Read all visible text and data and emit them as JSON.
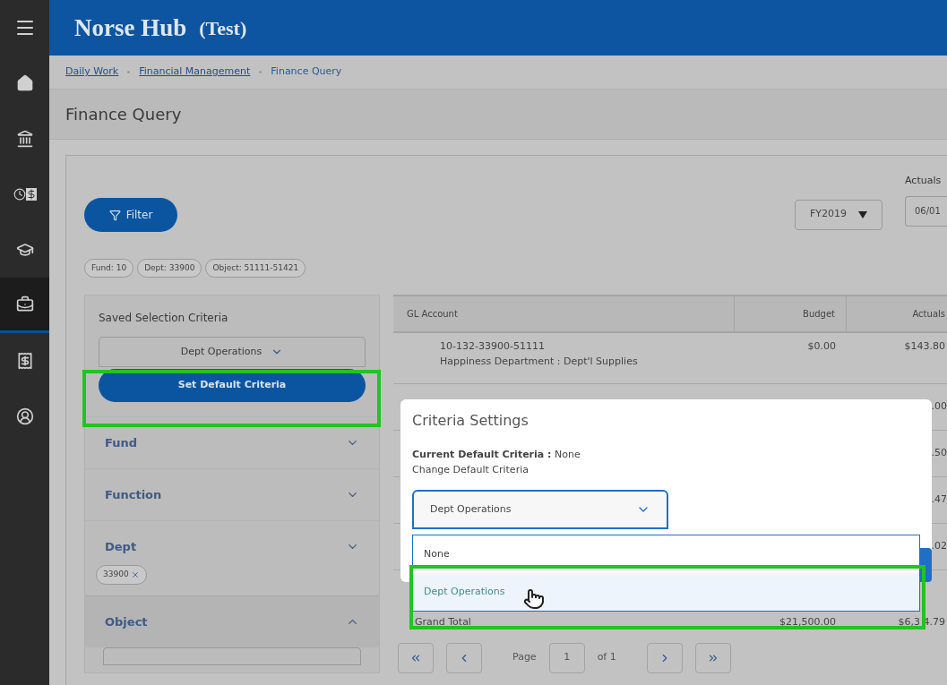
{
  "sidebar": {
    "items": [
      {
        "selected": false
      },
      {
        "selected": false
      },
      {
        "selected": false
      },
      {
        "selected": false
      },
      {
        "selected": true
      },
      {
        "selected": false
      },
      {
        "selected": false
      }
    ]
  },
  "header": {
    "title": "Norse Hub",
    "subtitle": "(Test)"
  },
  "breadcrumb": [
    {
      "label": "Daily Work",
      "link": true
    },
    {
      "label": "Financial Management",
      "link": true
    },
    {
      "label": "Finance Query",
      "link": false
    }
  ],
  "page_title": "Finance Query",
  "filter_button": "Filter",
  "fiscal_year": "FY2019",
  "actuals_label": "Actuals",
  "actuals_date": "06/01",
  "chips": [
    "Fund: 10",
    "Dept: 33900",
    "Object: 51111-51421"
  ],
  "criteria_panel": {
    "title": "Saved Selection Criteria",
    "saved": "Dept Operations",
    "button": "Set Default Criteria",
    "sections": [
      {
        "label": "Fund",
        "expanded": false
      },
      {
        "label": "Function",
        "expanded": false
      },
      {
        "label": "Dept",
        "expanded": false,
        "chips": [
          "33900"
        ]
      },
      {
        "label": "Object",
        "expanded": true
      }
    ]
  },
  "table": {
    "columns": [
      "GL Account",
      "Budget",
      "Actuals"
    ],
    "rows": [
      {
        "account": "10-132-33900-51111",
        "description": "Happiness Department : Dept'l Supplies",
        "budget": "$0.00",
        "actuals": "$143.80"
      },
      {
        "actuals": ".00"
      },
      {
        "actuals": ".50"
      },
      {
        "actuals": ".47"
      },
      {
        "actuals": ".02"
      }
    ],
    "total": {
      "label": "Grand Total",
      "budget": "$21,500.00",
      "actuals": "$6,3 4.79"
    }
  },
  "pagination": {
    "label": "Page",
    "page": "1",
    "of": "of 1"
  },
  "modal": {
    "title": "Criteria Settings",
    "current": "**Current Default Criteria :** None",
    "change_label": "Change Default Criteria",
    "value": "Dept Operations",
    "options": [
      {
        "label": "None",
        "selected": false
      },
      {
        "label": "Dept Operations",
        "selected": true
      }
    ]
  }
}
